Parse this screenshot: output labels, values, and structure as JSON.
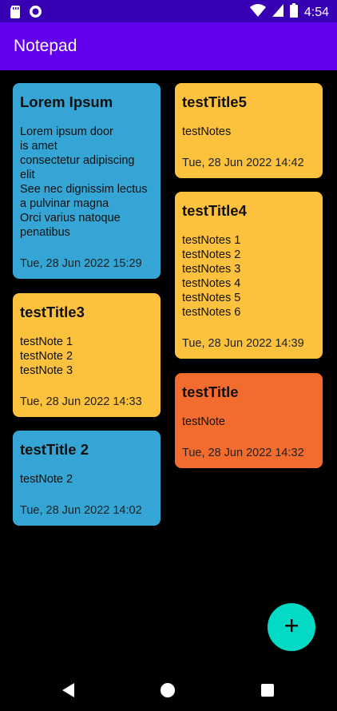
{
  "status_bar": {
    "time": "4:54",
    "left_icons": [
      "sd-card-icon",
      "record-icon"
    ],
    "right_icons": [
      "wifi-icon",
      "signal-icon",
      "battery-icon"
    ]
  },
  "app_bar": {
    "title": "Notepad"
  },
  "notes": [
    {
      "title": "Lorem Ipsum",
      "body": "Lorem ipsum door\nis amet\nconsectetur adipiscing\nelit\nSee nec dignissim lectus\na pulvinar magna\nOrci varius natoque\npenatibus",
      "date": "Tue, 28 Jun 2022 15:29",
      "color": "#34a5d4"
    },
    {
      "title": "testTitle3",
      "body": "testNote 1\ntestNote 2\ntestNote 3",
      "date": "Tue, 28 Jun 2022 14:33",
      "color": "#fcc13d"
    },
    {
      "title": "testTitle 2",
      "body": "testNote 2",
      "date": "Tue, 28 Jun 2022 14:02",
      "color": "#34a5d4"
    },
    {
      "title": "testTitle5",
      "body": "testNotes",
      "date": "Tue, 28 Jun 2022 14:42",
      "color": "#fcc13d"
    },
    {
      "title": "testTitle4",
      "body": "testNotes 1\ntestNotes 2\ntestNotes 3\ntestNotes 4\ntestNotes 5\ntestNotes 6",
      "date": "Tue, 28 Jun 2022 14:39",
      "color": "#fcc13d"
    },
    {
      "title": "testTitle",
      "body": "testNote",
      "date": "Tue, 28 Jun 2022 14:32",
      "color": "#f36c2d"
    }
  ],
  "fab": {
    "icon": "add-icon",
    "color": "#03dac5"
  },
  "nav_bar": {
    "icons": [
      "back-icon",
      "home-icon",
      "recents-icon"
    ]
  }
}
